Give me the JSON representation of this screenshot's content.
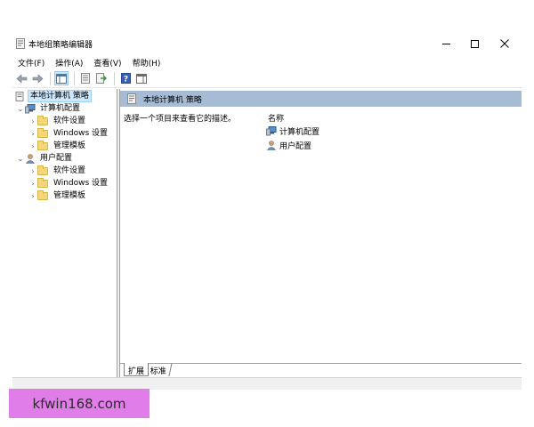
{
  "window": {
    "title": "本地组策略编辑器"
  },
  "menu": [
    {
      "label": "文件(F)"
    },
    {
      "label": "操作(A)"
    },
    {
      "label": "查看(V)"
    },
    {
      "label": "帮助(H)"
    }
  ],
  "toolbar": {
    "buttons": [
      "back-arrow-icon",
      "forward-arrow-icon",
      "show-hide-tree-icon",
      "properties-icon",
      "export-list-icon",
      "help-icon",
      "action-pane-icon"
    ]
  },
  "tree": {
    "root": "本地计算机 策略",
    "computer_config": "计算机配置",
    "user_config": "用户配置",
    "computer_children": [
      "软件设置",
      "Windows 设置",
      "管理模板"
    ],
    "user_children": [
      "软件设置",
      "Windows 设置",
      "管理模板"
    ]
  },
  "content": {
    "header_title": "本地计算机 策略",
    "description": "选择一个项目来查看它的描述。",
    "column_name": "名称",
    "items": [
      "计算机配置",
      "用户配置"
    ]
  },
  "tabs": {
    "extended": "扩展",
    "standard": "标准"
  },
  "watermark": "kfwin168.com",
  "colors": {
    "header_bg": "#a6bbd4",
    "selection_bg": "#cce8ff",
    "folder": "#f5d77a",
    "watermark_bg": "#e07de8"
  }
}
